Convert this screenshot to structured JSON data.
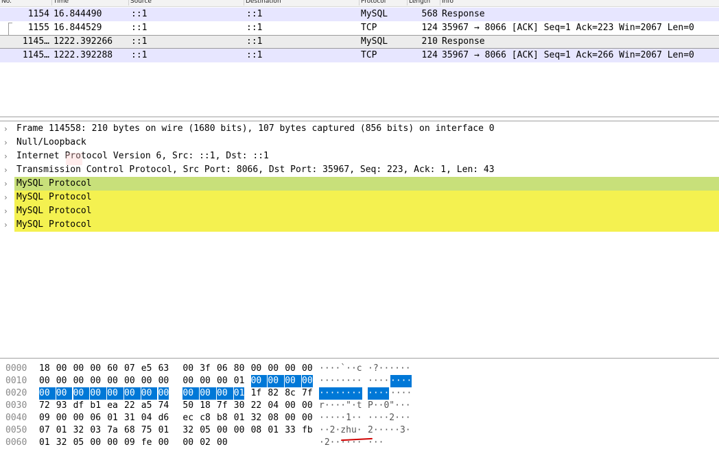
{
  "packet_list": {
    "columns": [
      "No.",
      "Time",
      "Source",
      "Destination",
      "Protocol",
      "Length",
      "Info"
    ],
    "rows": [
      {
        "no": "1154",
        "time": "16.844490",
        "source": "::1",
        "destination": "::1",
        "protocol": "MySQL",
        "length": "568",
        "info": "Response",
        "style": "mysql"
      },
      {
        "no": "1155",
        "time": "16.844529",
        "source": "::1",
        "destination": "::1",
        "protocol": "TCP",
        "length": "124",
        "info": "35967 → 8066 [ACK] Seq=1 Ack=223 Win=2067 Len=0",
        "style": "plain"
      },
      {
        "no": "1145…",
        "time": "1222.392266",
        "source": "::1",
        "destination": "::1",
        "protocol": "MySQL",
        "length": "210",
        "info": "Response",
        "style": "selected"
      },
      {
        "no": "1145…",
        "time": "1222.392288",
        "source": "::1",
        "destination": "::1",
        "protocol": "TCP",
        "length": "124",
        "info": "35967 → 8066 [ACK] Seq=1 Ack=266 Win=2067 Len=0",
        "style": "mysql"
      }
    ]
  },
  "details": {
    "items": [
      {
        "label": "Frame 114558: 210 bytes on wire (1680 bits), 107 bytes captured (856 bits) on interface 0",
        "highlight": "none"
      },
      {
        "label": "Null/Loopback",
        "highlight": "none"
      },
      {
        "label": "Internet Protocol Version 6, Src: ::1, Dst: ::1",
        "highlight": "none"
      },
      {
        "label": "Transmission Control Protocol, Src Port: 8066, Dst Port: 35967, Seq: 223, Ack: 1, Len: 43",
        "highlight": "none"
      },
      {
        "label": "MySQL Protocol",
        "highlight": "green"
      },
      {
        "label": "MySQL Protocol",
        "highlight": "yellow"
      },
      {
        "label": "MySQL Protocol",
        "highlight": "yellow"
      },
      {
        "label": "MySQL Protocol",
        "highlight": "yellow"
      }
    ],
    "expander_icon": "chevron-right-icon"
  },
  "hexdump": {
    "rows": [
      {
        "offset": "0000",
        "bytes": [
          "18",
          "00",
          "00",
          "00",
          "60",
          "07",
          "e5",
          "63",
          "00",
          "3f",
          "06",
          "80",
          "00",
          "00",
          "00",
          "00"
        ],
        "ascii_a": "····`··c",
        "ascii_b": "·?······",
        "sel_from": -1,
        "sel_to": -1
      },
      {
        "offset": "0010",
        "bytes": [
          "00",
          "00",
          "00",
          "00",
          "00",
          "00",
          "00",
          "00",
          "00",
          "00",
          "00",
          "01",
          "00",
          "00",
          "00",
          "00"
        ],
        "ascii_a": "········",
        "ascii_b": "····",
        "ascii_b_sel": "····",
        "sel_from": 12,
        "sel_to": 15
      },
      {
        "offset": "0020",
        "bytes": [
          "00",
          "00",
          "00",
          "00",
          "00",
          "00",
          "00",
          "00",
          "00",
          "00",
          "00",
          "01",
          "1f",
          "82",
          "8c",
          "7f"
        ],
        "ascii_a_sel": "········",
        "ascii_b_sel": "····",
        "ascii_b": "····",
        "sel_from": 0,
        "sel_to": 11
      },
      {
        "offset": "0030",
        "bytes": [
          "72",
          "93",
          "df",
          "b1",
          "ea",
          "22",
          "a5",
          "74",
          "50",
          "18",
          "7f",
          "30",
          "22",
          "04",
          "00",
          "00"
        ],
        "ascii_a": "r····\"·t",
        "ascii_b": "P··0\"···",
        "sel_from": -1,
        "sel_to": -1
      },
      {
        "offset": "0040",
        "bytes": [
          "09",
          "00",
          "00",
          "06",
          "01",
          "31",
          "04",
          "d6",
          "ec",
          "c8",
          "b8",
          "01",
          "32",
          "08",
          "00",
          "00"
        ],
        "ascii_a": "·····1··",
        "ascii_b": "····2···",
        "sel_from": -1,
        "sel_to": -1
      },
      {
        "offset": "0050",
        "bytes": [
          "07",
          "01",
          "32",
          "03",
          "7a",
          "68",
          "75",
          "01",
          "32",
          "05",
          "00",
          "00",
          "08",
          "01",
          "33",
          "fb"
        ],
        "ascii_a": "··2·zhu·",
        "ascii_b": "2·····3·",
        "sel_from": -1,
        "sel_to": -1
      },
      {
        "offset": "0060",
        "bytes": [
          "01",
          "32",
          "05",
          "00",
          "00",
          "09",
          "fe",
          "00",
          "00",
          "02",
          "00"
        ],
        "ascii_a": "·2······",
        "ascii_b": "···",
        "sel_from": -1,
        "sel_to": -1
      }
    ]
  },
  "colors": {
    "mysql_row": "#e7e6ff",
    "selected_row": "#ececec",
    "green_band": "#c8e07a",
    "yellow_band": "#f4f150",
    "hex_selection": "#0078d7",
    "annotation_underline": "#d00000"
  }
}
